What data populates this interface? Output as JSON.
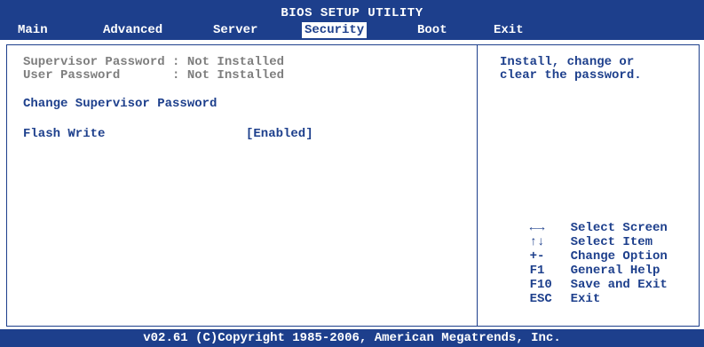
{
  "title": "BIOS SETUP UTILITY",
  "menu": [
    {
      "label": "Main"
    },
    {
      "label": "Advanced"
    },
    {
      "label": "Server"
    },
    {
      "label": "Security"
    },
    {
      "label": "Boot"
    },
    {
      "label": "Exit"
    }
  ],
  "active_menu": "Security",
  "items": {
    "supervisor_status": "Supervisor Password : Not Installed",
    "user_status": "User Password       : Not Installed",
    "change_supervisor": "Change Supervisor Password",
    "flash_write_label": "Flash Write",
    "flash_write_value": "[Enabled]"
  },
  "help_text": [
    "Install, change or",
    "clear the password."
  ],
  "keys": [
    {
      "key": "←→",
      "action": "Select Screen"
    },
    {
      "key": "↑↓",
      "action": "Select Item"
    },
    {
      "key": "+-",
      "action": "Change Option"
    },
    {
      "key": "F1",
      "action": "General Help"
    },
    {
      "key": "F10",
      "action": "Save and Exit"
    },
    {
      "key": "ESC",
      "action": "Exit"
    }
  ],
  "footer": "v02.61 (C)Copyright 1985-2006, American Megatrends, Inc.",
  "colors": {
    "primary": "#1d3f8c",
    "disabled_text": "#7e7e7e",
    "background": "#ffffff"
  }
}
